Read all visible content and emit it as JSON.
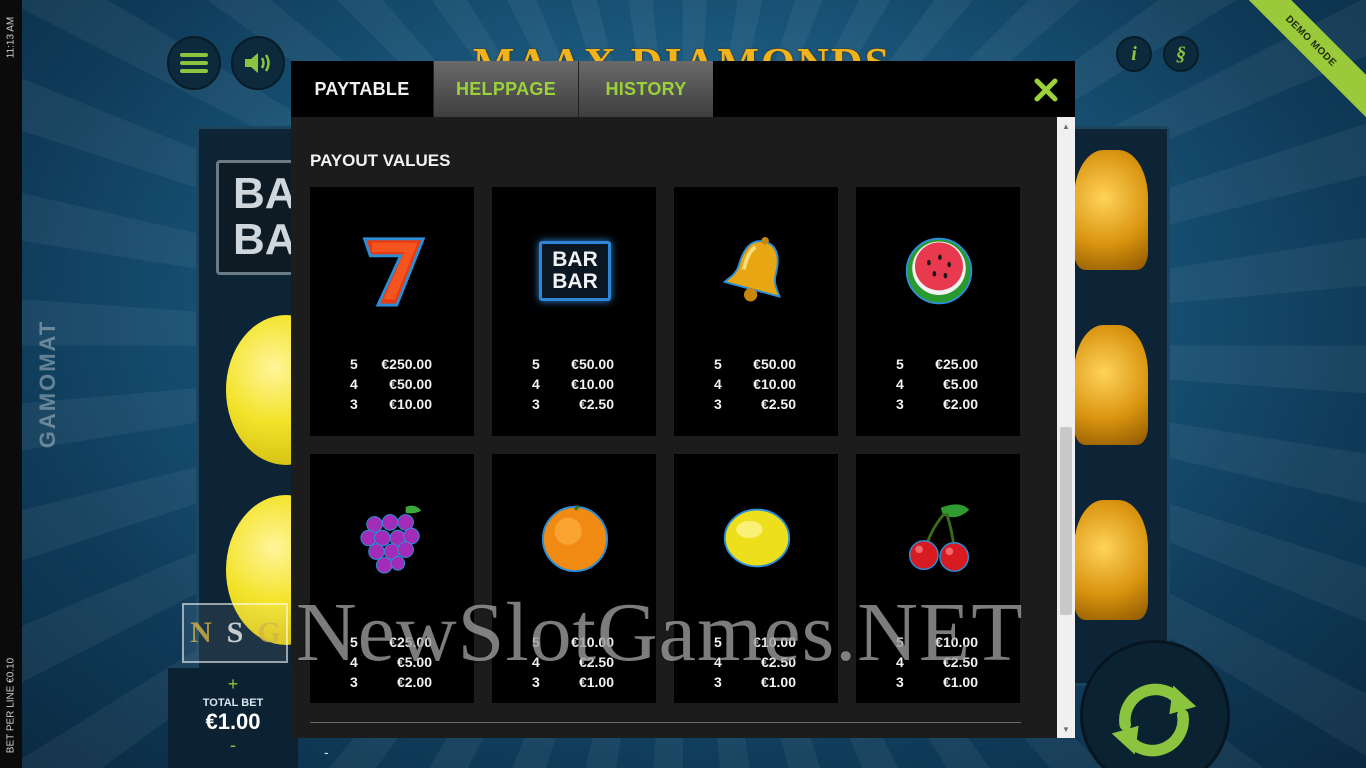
{
  "status": {
    "clock": "11:13 AM",
    "bet_per_line": "BET PER LINE €0.10",
    "demo_badge": "DEMO MODE",
    "brand_side": "GAMOMAT"
  },
  "game": {
    "title": "MAAX DIAMONDS",
    "bg_bar_text": "BAR BAR",
    "total_bet_label": "TOTAL BET",
    "total_bet_value": "€1.00",
    "plus": "+",
    "minus": "-"
  },
  "top_buttons": {
    "menu_icon": "menu-icon",
    "sound_icon": "sound-icon",
    "info_glyph": "i",
    "gamble_glyph": "§"
  },
  "modal": {
    "tabs": [
      {
        "label": "PAYTABLE",
        "active": true
      },
      {
        "label": "HELPPAGE",
        "active": false
      },
      {
        "label": "HISTORY",
        "active": false
      }
    ],
    "close_glyph": "✕",
    "section_title": "PAYOUT VALUES",
    "symbols": [
      {
        "icon": "seven-icon",
        "pays": [
          [
            "5",
            "€250.00"
          ],
          [
            "4",
            "€50.00"
          ],
          [
            "3",
            "€10.00"
          ]
        ]
      },
      {
        "icon": "bar-icon",
        "label": "BAR BAR",
        "pays": [
          [
            "5",
            "€50.00"
          ],
          [
            "4",
            "€10.00"
          ],
          [
            "3",
            "€2.50"
          ]
        ]
      },
      {
        "icon": "bell-icon",
        "pays": [
          [
            "5",
            "€50.00"
          ],
          [
            "4",
            "€10.00"
          ],
          [
            "3",
            "€2.50"
          ]
        ]
      },
      {
        "icon": "watermelon-icon",
        "pays": [
          [
            "5",
            "€25.00"
          ],
          [
            "4",
            "€5.00"
          ],
          [
            "3",
            "€2.00"
          ]
        ]
      },
      {
        "icon": "grapes-icon",
        "pays": [
          [
            "5",
            "€25.00"
          ],
          [
            "4",
            "€5.00"
          ],
          [
            "3",
            "€2.00"
          ]
        ]
      },
      {
        "icon": "orange-icon",
        "pays": [
          [
            "5",
            "€10.00"
          ],
          [
            "4",
            "€2.50"
          ],
          [
            "3",
            "€1.00"
          ]
        ]
      },
      {
        "icon": "lemon-icon",
        "pays": [
          [
            "5",
            "€10.00"
          ],
          [
            "4",
            "€2.50"
          ],
          [
            "3",
            "€1.00"
          ]
        ]
      },
      {
        "icon": "cherries-icon",
        "pays": [
          [
            "5",
            "€10.00"
          ],
          [
            "4",
            "€2.50"
          ],
          [
            "3",
            "€1.00"
          ]
        ]
      }
    ]
  },
  "watermark": {
    "logo_letters": [
      "N",
      "S",
      "G"
    ],
    "text": "NewSlotGames.NET"
  },
  "colors": {
    "accent_green": "#8bc53f",
    "tab_green_text": "#9bd23a",
    "card_bg": "#000000",
    "content_bg": "#1c1c1c"
  }
}
